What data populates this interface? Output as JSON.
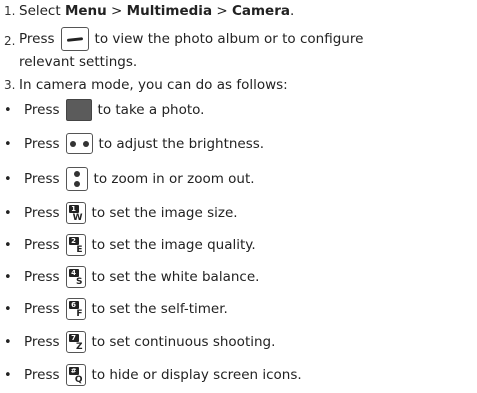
{
  "steps": [
    {
      "num": "1.",
      "pre": "Select ",
      "b1": "Menu",
      "s1": " > ",
      "b2": "Multimedia",
      "s2": " > ",
      "b3": "Camera",
      "post": "."
    },
    {
      "num": "2.",
      "pre": "Press",
      "post": "to view the photo album or to configure",
      "cont": "relevant settings.",
      "key": "left-soft-key-icon"
    },
    {
      "num": "3.",
      "text": "In camera mode, you can do as follows:"
    }
  ],
  "bullet_char": "•",
  "bullets": [
    {
      "pre": "Press",
      "post": "to take a photo.",
      "key": "camera-shutter-key-icon"
    },
    {
      "pre": "Press",
      "post": "to adjust the brightness.",
      "key": "left-right-nav-key-icon"
    },
    {
      "pre": "Press",
      "post": "to zoom in or zoom out.",
      "key": "up-down-nav-key-icon"
    },
    {
      "pre": "Press",
      "post": "to set the image size.",
      "key": "number-1-key-icon",
      "tag": "1",
      "letter": "W"
    },
    {
      "pre": "Press",
      "post": "to set the image quality.",
      "key": "number-2-key-icon",
      "tag": "2",
      "letter": "E"
    },
    {
      "pre": "Press",
      "post": "to set the white balance.",
      "key": "number-4-key-icon",
      "tag": "4",
      "letter": "S"
    },
    {
      "pre": "Press",
      "post": "to set the self-timer.",
      "key": "number-6-key-icon",
      "tag": "6",
      "letter": "F"
    },
    {
      "pre": "Press",
      "post": "to set continuous shooting.",
      "key": "number-7-key-icon",
      "tag": "7",
      "letter": "Z"
    },
    {
      "pre": "Press",
      "post": "to hide or display screen icons.",
      "key": "hash-key-icon",
      "tag": "#",
      "letter": "Q"
    }
  ]
}
